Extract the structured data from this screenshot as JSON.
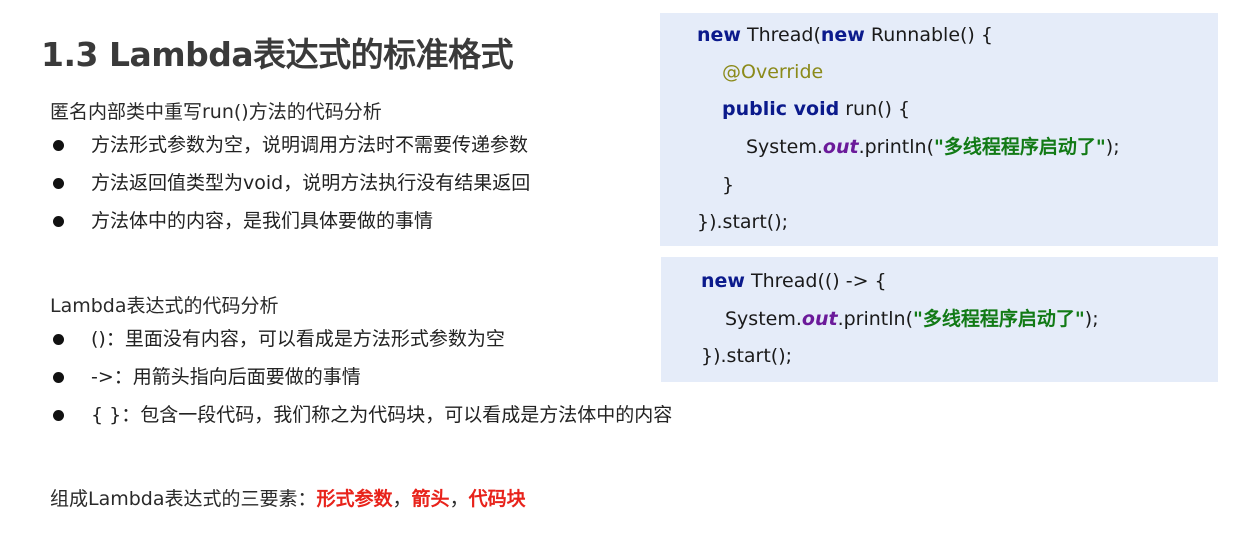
{
  "slide": {
    "title": "1.3 Lambda表达式的标准格式",
    "anon_section": {
      "heading": "匿名内部类中重写run()方法的代码分析",
      "bullets": [
        "方法形式参数为空，说明调用方法时不需要传递参数",
        "方法返回值类型为void，说明方法执行没有结果返回",
        "方法体中的内容，是我们具体要做的事情"
      ]
    },
    "lambda_section": {
      "heading": "Lambda表达式的代码分析",
      "bullets": [
        "()：里面没有内容，可以看成是方法形式参数为空",
        "->：用箭头指向后面要做的事情",
        "{ }：包含一段代码，我们称之为代码块，可以看成是方法体中的内容"
      ]
    },
    "summary": {
      "prefix": "组成Lambda表达式的三要素：",
      "elements": [
        "形式参数",
        "箭头",
        "代码块"
      ],
      "separator": "，"
    }
  },
  "code_anon": {
    "kw_new": "new",
    "thread_open": " Thread(",
    "runnable": " Runnable() {",
    "annotation": "@Override",
    "kw_public_void": "public void",
    "run_sig": " run() {",
    "sysout_prefix": "System.",
    "out": "out",
    "println_open": ".println(",
    "string_literal": "\"多线程程序启动了\"",
    "stmt_end": ");",
    "close_method": "}",
    "close_start": "}).start();"
  },
  "code_lambda": {
    "kw_new": "new",
    "thread_lambda": " Thread(() -> {",
    "sysout_prefix": "System.",
    "out": "out",
    "println_open": ".println(",
    "string_literal": "\"多线程程序启动了\"",
    "stmt_end": ");",
    "close_start": "}).start();"
  },
  "colors": {
    "keyword": "#0b1a8c",
    "annotation": "#8b8a1a",
    "static_field": "#6b1a9a",
    "string_literal": "#127a16",
    "highlight_red": "#e8231b",
    "code_background": "#e5ecf9"
  }
}
